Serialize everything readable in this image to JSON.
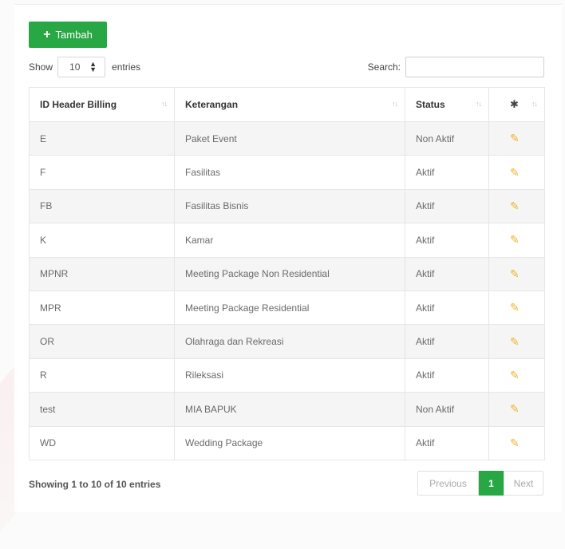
{
  "toolbar": {
    "add_label": "Tambah"
  },
  "length": {
    "prefix": "Show",
    "value": "10",
    "suffix": "entries"
  },
  "search": {
    "label": "Search:",
    "placeholder": ""
  },
  "table": {
    "headers": [
      "ID Header Billing",
      "Keterangan",
      "Status"
    ],
    "rows": [
      {
        "id": "E",
        "keterangan": "Paket Event",
        "status": "Non Aktif"
      },
      {
        "id": "F",
        "keterangan": "Fasilitas",
        "status": "Aktif"
      },
      {
        "id": "FB",
        "keterangan": "Fasilitas Bisnis",
        "status": "Aktif"
      },
      {
        "id": "K",
        "keterangan": "Kamar",
        "status": "Aktif"
      },
      {
        "id": "MPNR",
        "keterangan": "Meeting Package Non Residential",
        "status": "Aktif"
      },
      {
        "id": "MPR",
        "keterangan": "Meeting Package Residential",
        "status": "Aktif"
      },
      {
        "id": "OR",
        "keterangan": "Olahraga dan Rekreasi",
        "status": "Aktif"
      },
      {
        "id": "R",
        "keterangan": "Rileksasi",
        "status": "Aktif"
      },
      {
        "id": "test",
        "keterangan": "MIA BAPUK",
        "status": "Non Aktif"
      },
      {
        "id": "WD",
        "keterangan": "Wedding Package",
        "status": "Aktif"
      }
    ]
  },
  "footer": {
    "info": "Showing 1 to 10 of 10 entries",
    "previous": "Previous",
    "current_page": "1",
    "next": "Next"
  },
  "colors": {
    "primary": "#28a745",
    "edit_icon": "#f0b429"
  }
}
